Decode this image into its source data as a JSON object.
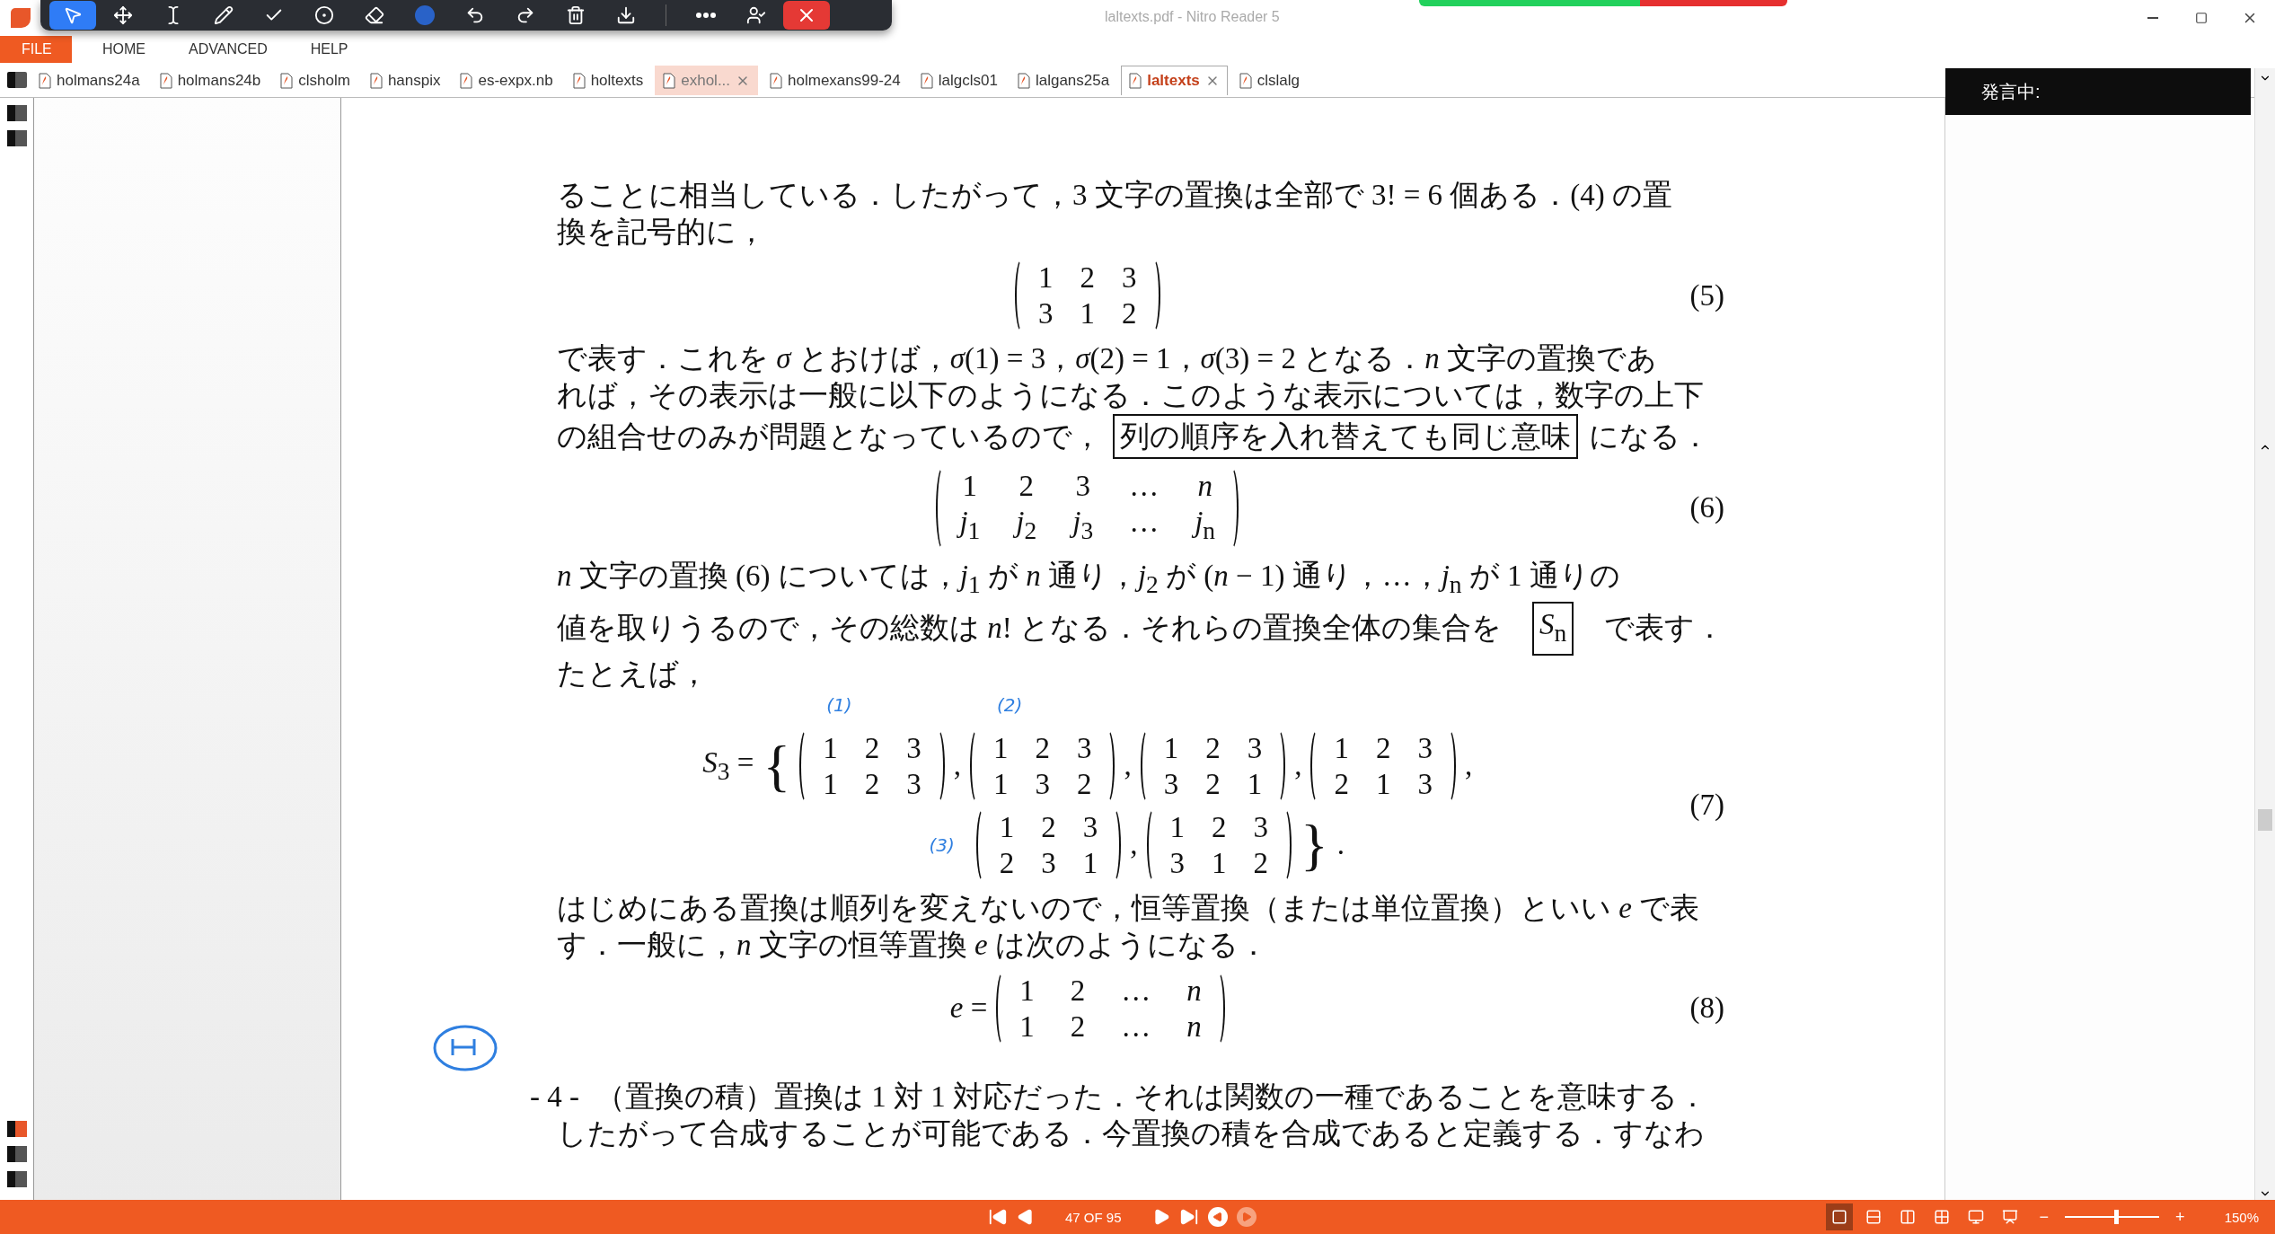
{
  "window": {
    "title": "laltexts.pdf - Nitro Reader 5"
  },
  "menu": [
    {
      "label": "FILE",
      "selected": true
    },
    {
      "label": "HOME",
      "selected": false
    },
    {
      "label": "ADVANCED",
      "selected": false
    },
    {
      "label": "HELP",
      "selected": false
    }
  ],
  "tabs": [
    {
      "label": "holmans24a",
      "selected": false,
      "highlighted": false,
      "closable": false
    },
    {
      "label": "holmans24b",
      "selected": false,
      "highlighted": false,
      "closable": false
    },
    {
      "label": "clsholm",
      "selected": false,
      "highlighted": false,
      "closable": false
    },
    {
      "label": "hanspix",
      "selected": false,
      "highlighted": false,
      "closable": false
    },
    {
      "label": "es-expx.nb",
      "selected": false,
      "highlighted": false,
      "closable": false
    },
    {
      "label": "holtexts",
      "selected": false,
      "highlighted": false,
      "closable": false
    },
    {
      "label": "exhol...",
      "selected": false,
      "highlighted": true,
      "closable": true
    },
    {
      "label": "holmexans99-24",
      "selected": false,
      "highlighted": false,
      "closable": false
    },
    {
      "label": "lalgcls01",
      "selected": false,
      "highlighted": false,
      "closable": false
    },
    {
      "label": "lalgans25a",
      "selected": false,
      "highlighted": false,
      "closable": false
    },
    {
      "label": "laltexts",
      "selected": true,
      "highlighted": false,
      "closable": true
    },
    {
      "label": "clslalg",
      "selected": false,
      "highlighted": false,
      "closable": false
    }
  ],
  "speech_panel": {
    "label": "発言中:"
  },
  "document": [
    {
      "kind": "para",
      "lines": [
        [
          {
            "text": "ることに相当している．したがって，3 文字の置換は全部で 3! = 6 個ある．(4) の置",
            "boxed": false
          }
        ],
        [
          {
            "text": "換を記号的に，",
            "boxed": false
          }
        ]
      ]
    },
    {
      "kind": "equation",
      "number": "(5)",
      "lines": [
        {
          "matrices": [
            {
              "rows": [
                [
                  "1",
                  "2",
                  "3"
                ],
                [
                  "3",
                  "1",
                  "2"
                ]
              ]
            }
          ]
        }
      ]
    },
    {
      "kind": "para",
      "lines": [
        [
          {
            "text": "で表す．これを *σ* とおけば，*σ*(1) = 3，*σ*(2) = 1，*σ*(3) = 2 となる．*n* 文字の置換であ",
            "boxed": false
          }
        ],
        [
          {
            "text": "れば，その表示は一般に以下のようになる．このような表示については，数字の上下",
            "boxed": false
          }
        ],
        [
          {
            "text": "の組合せのみが問題となっているので，",
            "boxed": false
          },
          {
            "text": "列の順序を入れ替えても同じ意味",
            "boxed": true
          },
          {
            "text": "になる．",
            "boxed": false
          }
        ]
      ]
    },
    {
      "kind": "equation",
      "number": "(6)",
      "lines": [
        {
          "matrices": [
            {
              "rows": [
                [
                  "1",
                  "2",
                  "3",
                  "…",
                  "*n*"
                ],
                [
                  "*j*$_{1}$",
                  "*j*$_{2}$",
                  "*j*$_{3}$",
                  "…",
                  "*j*$_{n}$"
                ]
              ]
            }
          ]
        }
      ]
    },
    {
      "kind": "para",
      "lines": [
        [
          {
            "text": "*n* 文字の置換 (6) については，*j*$_{1}$ が *n* 通り，*j*$_{2}$ が (*n* − 1) 通り，…，*j*$_{n}$ が 1 通りの",
            "boxed": false
          }
        ],
        [
          {
            "text": "値を取りうるので，その総数は *n*! となる．それらの置換全体の集合を",
            "boxed": false
          },
          {
            "text": "*S*$_{n}$",
            "boxed": true
          },
          {
            "text": "で表す．",
            "boxed": false
          }
        ],
        [
          {
            "text": "たとえば，",
            "boxed": false
          }
        ]
      ]
    },
    {
      "kind": "equation",
      "number": "(7)",
      "lines": [
        {
          "lead": "*S*$_{3}$ =",
          "open": "{",
          "matrices": [
            {
              "rows": [
                [
                  "1",
                  "2",
                  "3"
                ],
                [
                  "1",
                  "2",
                  "3"
                ]
              ],
              "ink": "(1)"
            },
            {
              "rows": [
                [
                  "1",
                  "2",
                  "3"
                ],
                [
                  "1",
                  "3",
                  "2"
                ]
              ],
              "ink": "(2)"
            },
            {
              "rows": [
                [
                  "1",
                  "2",
                  "3"
                ],
                [
                  "3",
                  "2",
                  "1"
                ]
              ]
            },
            {
              "rows": [
                [
                  "1",
                  "2",
                  "3"
                ],
                [
                  "2",
                  "1",
                  "3"
                ]
              ]
            }
          ],
          "sep": ",",
          "tail": ","
        },
        {
          "ink": "(3)",
          "matrices": [
            {
              "rows": [
                [
                  "1",
                  "2",
                  "3"
                ],
                [
                  "2",
                  "3",
                  "1"
                ]
              ]
            },
            {
              "rows": [
                [
                  "1",
                  "2",
                  "3"
                ],
                [
                  "3",
                  "1",
                  "2"
                ]
              ]
            }
          ],
          "sep": ",",
          "close": "}",
          "tail": "."
        }
      ]
    },
    {
      "kind": "para",
      "lines": [
        [
          {
            "text": "はじめにある置換は順列を変えないので，恒等置換（または単位置換）といい *e* で表",
            "boxed": false
          }
        ],
        [
          {
            "text": "す．一般に，*n* 文字の恒等置換 *e* は次のようになる．",
            "boxed": false
          }
        ]
      ]
    },
    {
      "kind": "equation",
      "number": "(8)",
      "lines": [
        {
          "lead": "*e* =",
          "matrices": [
            {
              "rows": [
                [
                  "1",
                  "2",
                  "…",
                  "*n*"
                ],
                [
                  "1",
                  "2",
                  "…",
                  "*n*"
                ]
              ]
            }
          ]
        }
      ]
    },
    {
      "kind": "footer",
      "page_number": "- 4 -",
      "lines": [
        [
          {
            "text": "（置換の積）置換は 1 対 1 対応だった．それは関数の一種であることを意味する．",
            "boxed": false
          }
        ],
        [
          {
            "text": "したがって合成することが可能である．今置換の積を合成であると定義する．すなわ",
            "boxed": false
          }
        ]
      ]
    }
  ],
  "status_bar": {
    "page": "47 OF 95",
    "views": [
      {
        "selected": true
      },
      {
        "selected": false
      },
      {
        "selected": false
      },
      {
        "selected": false
      },
      {
        "selected": false
      },
      {
        "selected": false
      }
    ],
    "zoom_out": "−",
    "zoom_in": "+",
    "zoom": {
      "level": 0.55
    },
    "zoom_label": "150%"
  }
}
